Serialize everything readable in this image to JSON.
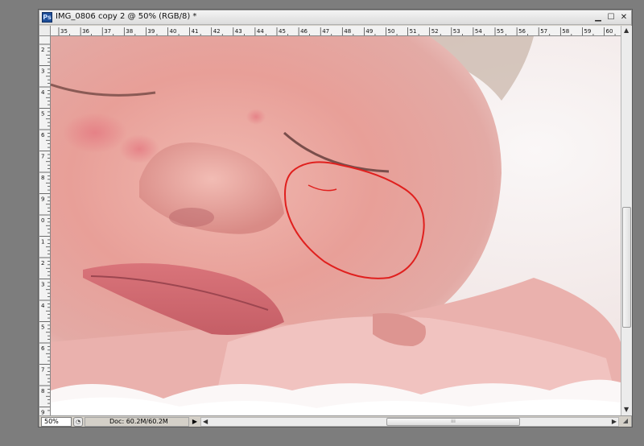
{
  "window": {
    "app_icon": "photoshop-icon",
    "app_icon_text": "Ps",
    "title": "IMG_0806 copy 2 @ 50% (RGB/8) *",
    "minimize_glyph": "▁",
    "maximize_glyph": "☐",
    "close_glyph": "✕"
  },
  "rulers": {
    "horizontal_labels": [
      "35",
      "36",
      "37",
      "38",
      "39",
      "40",
      "41",
      "42",
      "43",
      "44",
      "45",
      "46",
      "47",
      "48",
      "49",
      "50",
      "51",
      "52",
      "53",
      "54",
      "55",
      "56",
      "57",
      "58",
      "59",
      "60"
    ],
    "vertical_labels": [
      "2",
      "3",
      "4",
      "5",
      "6",
      "7",
      "8",
      "9",
      "0",
      "1",
      "2",
      "3",
      "4",
      "5",
      "6",
      "7",
      "8",
      "9",
      "0",
      "1"
    ]
  },
  "status": {
    "zoom": "50%",
    "doc_info": "Doc: 60.2M/60.2M",
    "menu_arrow": "▶",
    "scroll_left": "◀",
    "scroll_right": "▶",
    "scroll_up": "▲",
    "scroll_down": "▼",
    "grip_glyph": "⁞⁞⁞",
    "resize_glyph": "◢"
  },
  "colors": {
    "annotation": "#e0201e",
    "chrome": "#d4d0c8",
    "workspace": "#7d7d7d"
  }
}
